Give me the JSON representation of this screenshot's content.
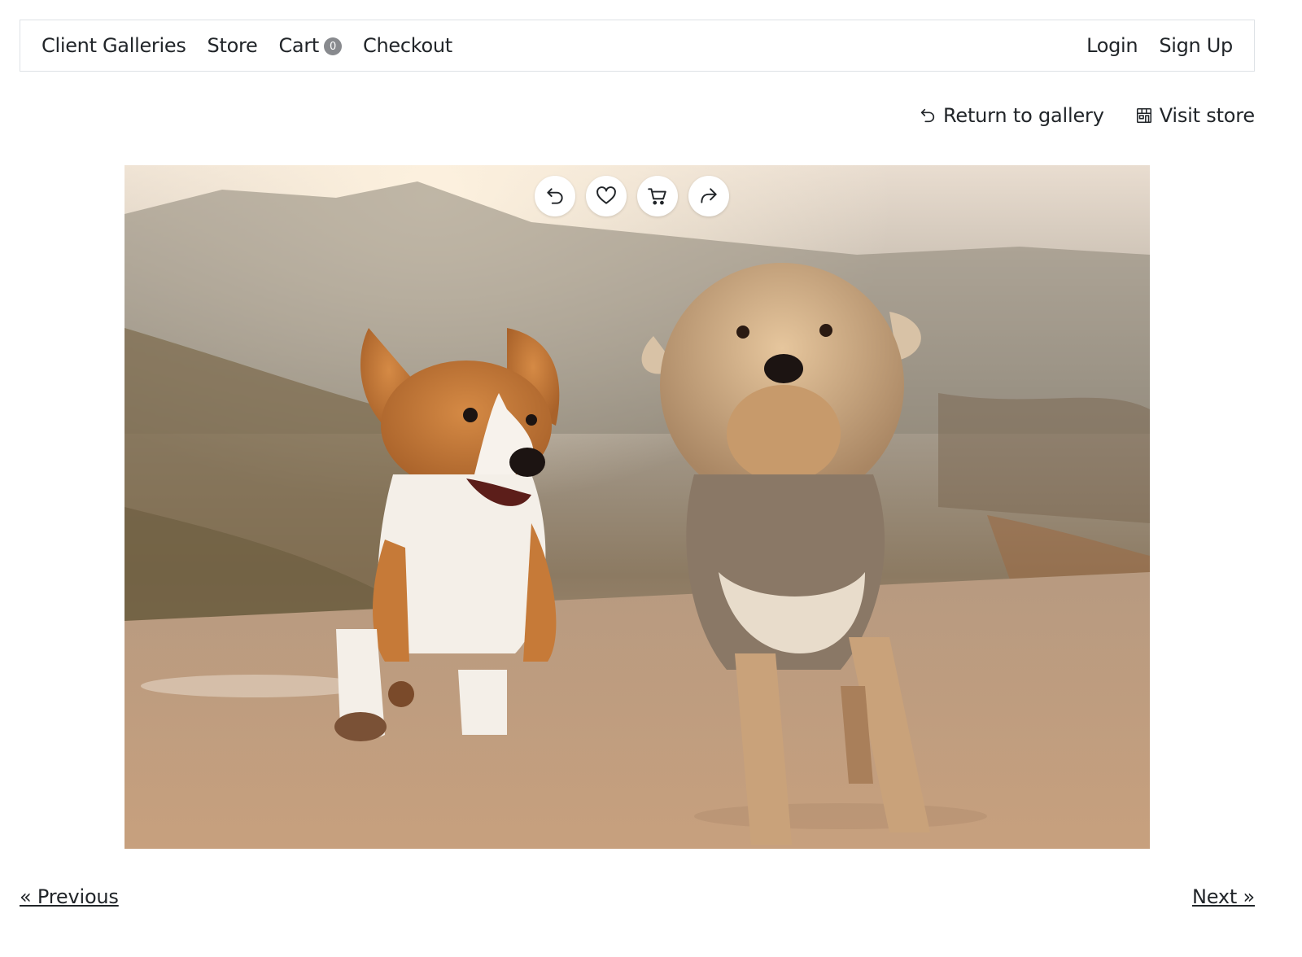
{
  "nav": {
    "left_items": [
      {
        "label": "Client Galleries"
      },
      {
        "label": "Store"
      },
      {
        "label": "Cart",
        "badge": "0"
      },
      {
        "label": "Checkout"
      }
    ],
    "right_items": [
      {
        "label": "Login"
      },
      {
        "label": "Sign Up"
      }
    ]
  },
  "actions": {
    "return_label": "Return to gallery",
    "return_icon": "undo-arrow-icon",
    "visit_label": "Visit store",
    "visit_icon": "store-icon"
  },
  "photo": {
    "toolbar": [
      {
        "icon": "undo-icon"
      },
      {
        "icon": "heart-icon"
      },
      {
        "icon": "cart-icon"
      },
      {
        "icon": "share-icon"
      }
    ]
  },
  "pager": {
    "previous_label": "« Previous",
    "next_label": "Next »"
  },
  "colors": {
    "badge": "#888a8e",
    "border": "#dee2e6",
    "text": "#212529"
  }
}
